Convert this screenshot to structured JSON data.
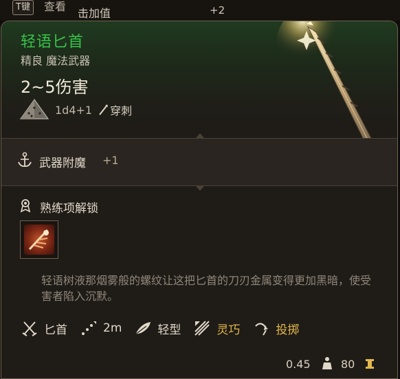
{
  "top": {
    "key_hint": "T键",
    "view_label": "查看",
    "stat_label": "击加值",
    "stat_value": "+2"
  },
  "item": {
    "name": "轻语匕首",
    "type": "精良 魔法武器",
    "damage": "2~5伤害",
    "dice": "1d4+1",
    "damage_type": "穿刺",
    "enchant_label": "武器附魔",
    "enchant_value": "+1",
    "proficiency_label": "熟练项解锁",
    "description": "轻语树液那烟雾般的螺纹让这把匕首的刀刃金属变得更加黑暗，使受害者陷入沉默。",
    "properties": [
      {
        "icon": "crossed-daggers-icon",
        "label": "匕首"
      },
      {
        "icon": "range-dots-icon",
        "label": "2m"
      },
      {
        "icon": "feather-icon",
        "label": "轻型"
      },
      {
        "icon": "finesse-slash-icon",
        "label": "灵巧"
      },
      {
        "icon": "thrown-arc-icon",
        "label": "投掷"
      }
    ],
    "weight": "0.45",
    "price": "80"
  },
  "colors": {
    "name": "#37c24a",
    "gold": "#e2b84a",
    "border": "#6e6352"
  }
}
